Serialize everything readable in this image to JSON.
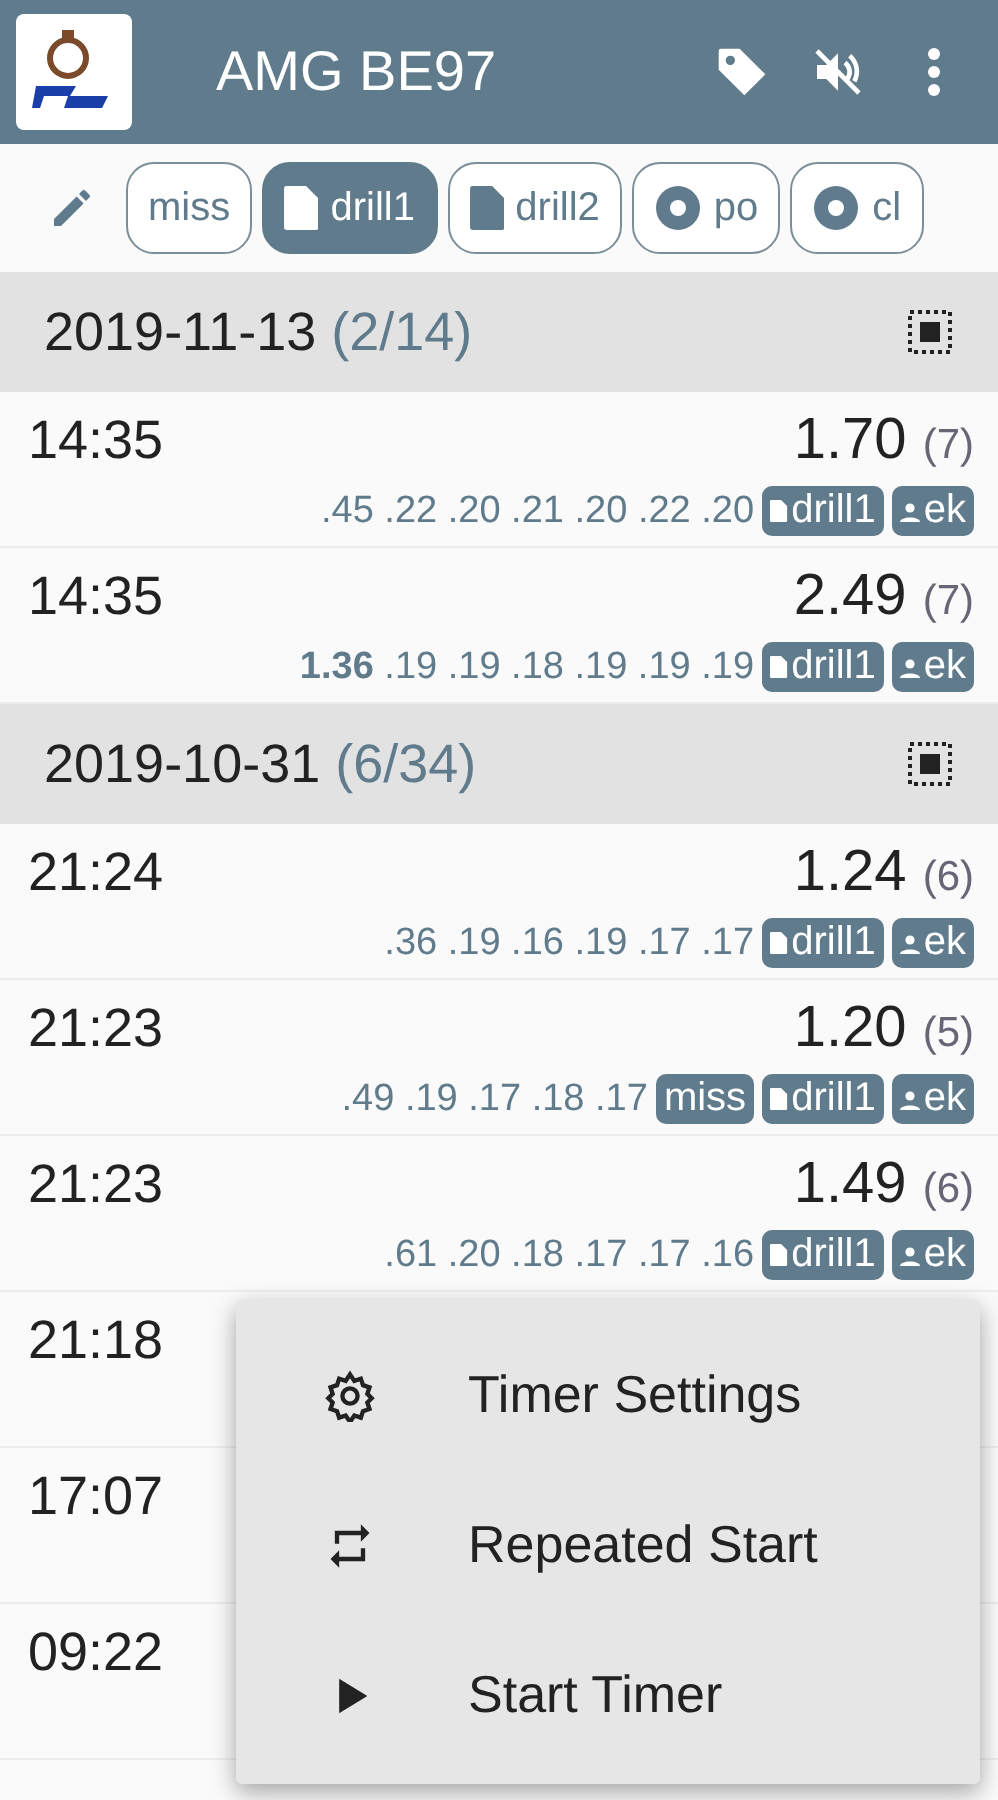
{
  "app_bar": {
    "title": "AMG BE97"
  },
  "filters": [
    {
      "label": "miss",
      "kind": "plain",
      "selected": false
    },
    {
      "label": "drill1",
      "kind": "file",
      "selected": true
    },
    {
      "label": "drill2",
      "kind": "file",
      "selected": false
    },
    {
      "label": "po",
      "kind": "disc",
      "selected": false
    },
    {
      "label": "cl",
      "kind": "disc",
      "selected": false
    }
  ],
  "sessions": [
    {
      "date": "2019-11-13",
      "count": "(2/14)",
      "runs": [
        {
          "time": "14:35",
          "total": "1.70",
          "shots": "(7)",
          "splits": ".45 .22 .20 .21 .20 .22 .20",
          "tags": [
            {
              "label": "drill1",
              "kind": "file"
            },
            {
              "label": "ek",
              "kind": "person"
            }
          ]
        },
        {
          "time": "14:35",
          "total": "2.49",
          "shots": "(7)",
          "splits": "**1.36** .19 .19 .18 .19 .19 .19",
          "tags": [
            {
              "label": "drill1",
              "kind": "file"
            },
            {
              "label": "ek",
              "kind": "person"
            }
          ]
        }
      ]
    },
    {
      "date": "2019-10-31",
      "count": "(6/34)",
      "runs": [
        {
          "time": "21:24",
          "total": "1.24",
          "shots": "(6)",
          "splits": ".36 .19 .16 .19 .17 .17",
          "tags": [
            {
              "label": "drill1",
              "kind": "file"
            },
            {
              "label": "ek",
              "kind": "person"
            }
          ]
        },
        {
          "time": "21:23",
          "total": "1.20",
          "shots": "(5)",
          "splits": ".49 .19 .17 .18 .17",
          "tags": [
            {
              "label": "miss",
              "kind": "plain"
            },
            {
              "label": "drill1",
              "kind": "file"
            },
            {
              "label": "ek",
              "kind": "person"
            }
          ]
        },
        {
          "time": "21:23",
          "total": "1.49",
          "shots": "(6)",
          "splits": ".61 .20 .18 .17 .17 .16",
          "tags": [
            {
              "label": "drill1",
              "kind": "file"
            },
            {
              "label": "ek",
              "kind": "person"
            }
          ]
        },
        {
          "time": "21:18"
        },
        {
          "time": "17:07"
        },
        {
          "time": "09:22"
        }
      ]
    }
  ],
  "menu": [
    {
      "label": "Timer Settings",
      "kind": "settings"
    },
    {
      "label": "Repeated Start",
      "kind": "repeat"
    },
    {
      "label": "Start Timer",
      "kind": "play"
    }
  ]
}
